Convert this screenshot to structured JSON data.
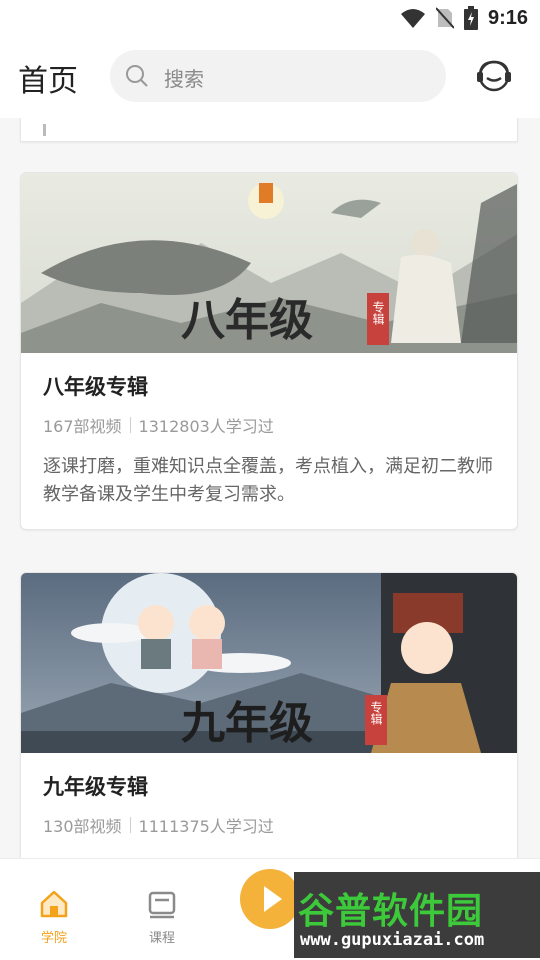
{
  "status_bar": {
    "time": "9:16"
  },
  "header": {
    "title": "首页",
    "search_placeholder": "搜索"
  },
  "cards": [
    {
      "banner_text": "八年级",
      "banner_tag": "专辑",
      "title": "八年级专辑",
      "videos": "167部视频",
      "learners": "1312803人学习过",
      "description": "逐课打磨，重难知识点全覆盖，考点植入，满足初二教师教学备课及学生中考复习需求。"
    },
    {
      "banner_text": "九年级",
      "banner_tag": "专辑",
      "title": "九年级专辑",
      "videos": "130部视频",
      "learners": "1111375人学习过"
    }
  ],
  "tabbar": {
    "tabs": [
      {
        "label": "学院",
        "active": true
      },
      {
        "label": "课程",
        "active": false
      }
    ],
    "accent_color": "#f4a21a"
  },
  "watermark": {
    "logo": "谷普软件园",
    "url": "www.gupuxiazai.com"
  }
}
